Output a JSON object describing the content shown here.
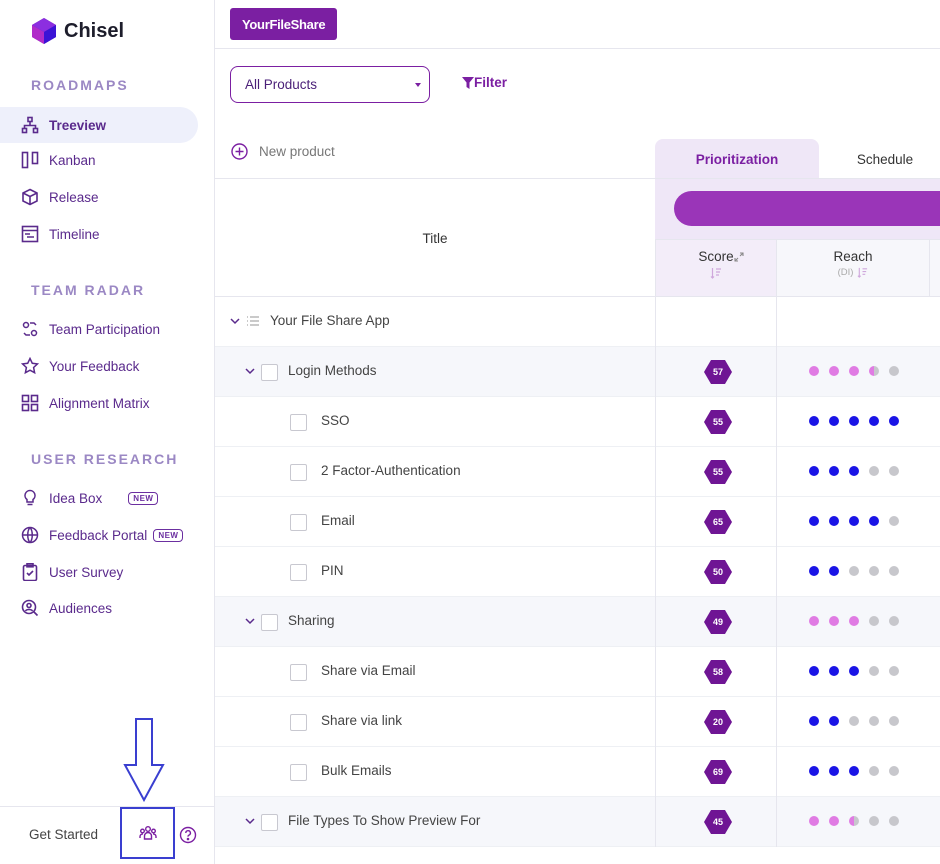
{
  "brand": {
    "name": "Chisel"
  },
  "sidebar": {
    "sections": [
      {
        "title": "ROADMAPS"
      },
      {
        "title": "TEAM RADAR"
      },
      {
        "title": "USER RESEARCH"
      }
    ],
    "items": [
      {
        "label": "Treeview",
        "icon": "tree-icon",
        "active": true
      },
      {
        "label": "Kanban",
        "icon": "kanban-icon"
      },
      {
        "label": "Release",
        "icon": "box-icon"
      },
      {
        "label": "Timeline",
        "icon": "timeline-icon"
      },
      {
        "label": "Team Participation",
        "icon": "team-participation-icon"
      },
      {
        "label": "Your Feedback",
        "icon": "star-icon"
      },
      {
        "label": "Alignment Matrix",
        "icon": "grid-icon"
      },
      {
        "label": "Idea Box",
        "icon": "lightbulb-icon",
        "badge": "NEW"
      },
      {
        "label": "Feedback Portal",
        "icon": "globe-icon",
        "badge": "NEW"
      },
      {
        "label": "User Survey",
        "icon": "clipboard-icon"
      },
      {
        "label": "Audiences",
        "icon": "audience-icon"
      }
    ],
    "footer": {
      "get_started": "Get Started"
    }
  },
  "topbar": {
    "workspace": "YourFileShare"
  },
  "toolbar": {
    "product_select": "All Products",
    "filter": "Filter",
    "new_product": "New product"
  },
  "tabs": [
    {
      "label": "Prioritization",
      "active": true
    },
    {
      "label": "Schedule"
    }
  ],
  "table": {
    "title_header": "Title",
    "columns": [
      {
        "label": "Score"
      },
      {
        "label": "Reach",
        "sub": "(DI)"
      }
    ],
    "product_row": {
      "label": "Your File Share App"
    },
    "rows": [
      {
        "label": "Login Methods",
        "group": true,
        "score": "57",
        "reach": [
          1,
          1,
          1,
          0.5,
          0
        ]
      },
      {
        "label": "SSO",
        "score": "55",
        "reach": [
          1,
          1,
          1,
          1,
          1
        ]
      },
      {
        "label": "2 Factor-Authentication",
        "score": "55",
        "reach": [
          1,
          1,
          1,
          0,
          0
        ]
      },
      {
        "label": "Email",
        "score": "65",
        "reach": [
          1,
          1,
          1,
          1,
          0
        ]
      },
      {
        "label": "PIN",
        "score": "50",
        "reach": [
          1,
          1,
          0,
          0,
          0
        ]
      },
      {
        "label": "Sharing",
        "group": true,
        "score": "49",
        "reach": [
          1,
          1,
          1,
          0,
          0
        ]
      },
      {
        "label": "Share via Email",
        "score": "58",
        "reach": [
          1,
          1,
          1,
          0,
          0
        ]
      },
      {
        "label": "Share via link",
        "score": "20",
        "reach": [
          1,
          1,
          0,
          0,
          0
        ]
      },
      {
        "label": "Bulk Emails",
        "score": "69",
        "reach": [
          1,
          1,
          1,
          0,
          0
        ]
      },
      {
        "label": "File Types To Show Preview For",
        "group": true,
        "score": "45",
        "reach": [
          1,
          1,
          0.5,
          0,
          0
        ]
      }
    ]
  },
  "colors": {
    "accent": "#7b1fa2",
    "score_hex": "#6f1594",
    "dot_feature": "#1a14e6",
    "dot_group": "#e07be3",
    "dot_empty": "#c7c7cc"
  }
}
